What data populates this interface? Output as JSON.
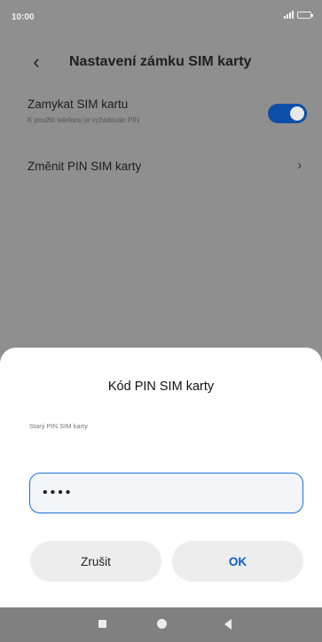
{
  "status_bar": {
    "time": "10:00",
    "icons": [
      "signal-icon",
      "battery-icon"
    ]
  },
  "header": {
    "back_icon": "chevron-left-icon",
    "title": "Nastavení zámku SIM karty"
  },
  "settings": {
    "lock_sim": {
      "title": "Zamykat SIM kartu",
      "subtitle": "K použití telefonu je vyžadován PIN",
      "enabled": true
    },
    "change_pin": {
      "title": "Změnit PIN SIM karty"
    }
  },
  "dialog": {
    "title": "Kód PIN SIM karty",
    "hint": "Starý PIN SIM karty",
    "pin_value": "••••",
    "cancel_label": "Zrušit",
    "ok_label": "OK"
  },
  "colors": {
    "accent": "#1a6fd6",
    "toggle_on": "#0d4fa8",
    "overlay_background": "#8f8f8f"
  }
}
